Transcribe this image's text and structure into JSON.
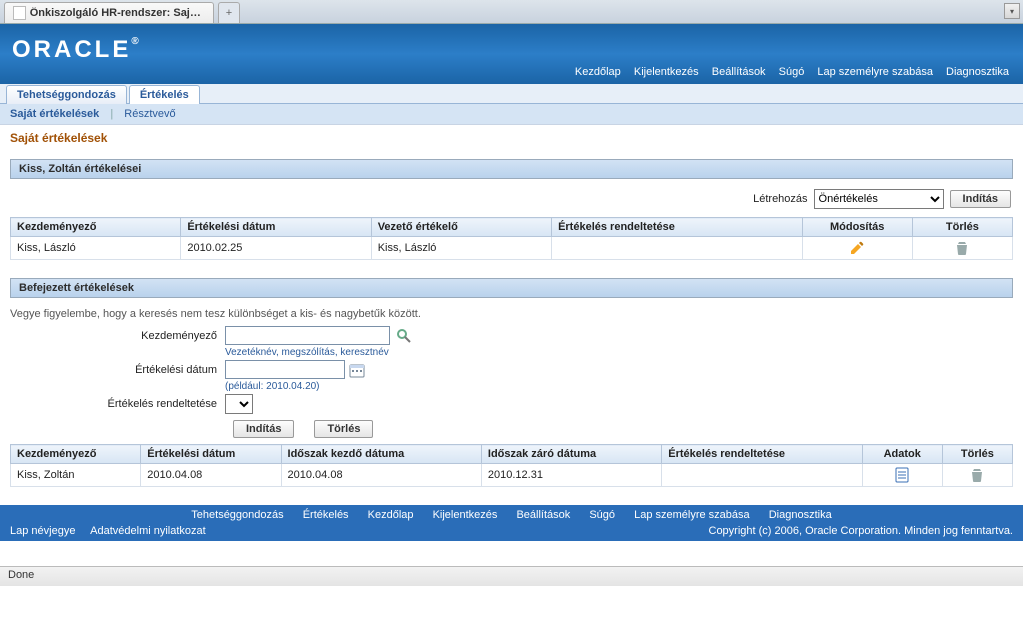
{
  "browser": {
    "tab_title": "Önkiszolgáló HR-rendszer: Saját ért...",
    "newtab": "+",
    "menu_glyph": "▾",
    "status": "Done"
  },
  "brand": "ORACLE",
  "brand_r": "®",
  "headerLinks": [
    "Kezdőlap",
    "Kijelentkezés",
    "Beállítások",
    "Súgó",
    "Lap személyre szabása",
    "Diagnosztika"
  ],
  "mainTabs": {
    "a": "Tehetséggondozás",
    "b": "Értékelés"
  },
  "subTabs": {
    "a": "Saját értékelések",
    "b": "Résztvevő"
  },
  "page_title": "Saját értékelések",
  "panel1": {
    "title": "Kiss, Zoltán értékelései",
    "create_label": "Létrehozás",
    "create_select_option": "Önértékelés",
    "start_button": "Indítás",
    "cols": {
      "c1": "Kezdeményező",
      "c2": "Értékelési dátum",
      "c3": "Vezető értékelő",
      "c4": "Értékelés rendeltetése",
      "c5": "Módosítás",
      "c6": "Törlés"
    },
    "row": {
      "initiator": "Kiss, László",
      "date": "2010.02.25",
      "lead": "Kiss, László",
      "purpose": ""
    }
  },
  "panel2": {
    "title": "Befejezett értékelések",
    "note": "Vegye figyelembe, hogy a keresés nem tesz különbséget a kis- és nagybetűk között.",
    "f1_label": "Kezdeményező",
    "f1_hint": "Vezetéknév, megszólítás, keresztnév",
    "f2_label": "Értékelési dátum",
    "f2_hint": "(például: 2010.04.20)",
    "f3_label": "Értékelés rendeltetése",
    "btn_go": "Indítás",
    "btn_clear": "Törlés",
    "cols": {
      "c1": "Kezdeményező",
      "c2": "Értékelési dátum",
      "c3": "Időszak kezdő dátuma",
      "c4": "Időszak záró dátuma",
      "c5": "Értékelés rendeltetése",
      "c6": "Adatok",
      "c7": "Törlés"
    },
    "row": {
      "initiator": "Kiss, Zoltán",
      "date": "2010.04.08",
      "start": "2010.04.08",
      "end": "2010.12.31",
      "purpose": ""
    }
  },
  "footer": {
    "links": [
      "Tehetséggondozás",
      "Értékelés",
      "Kezdőlap",
      "Kijelentkezés",
      "Beállítások",
      "Súgó",
      "Lap személyre szabása",
      "Diagnosztika"
    ],
    "bl1": "Lap névjegye",
    "bl2": "Adatvédelmi nyilatkozat",
    "copyright": "Copyright (c) 2006, Oracle Corporation. Minden jog fenntartva."
  }
}
